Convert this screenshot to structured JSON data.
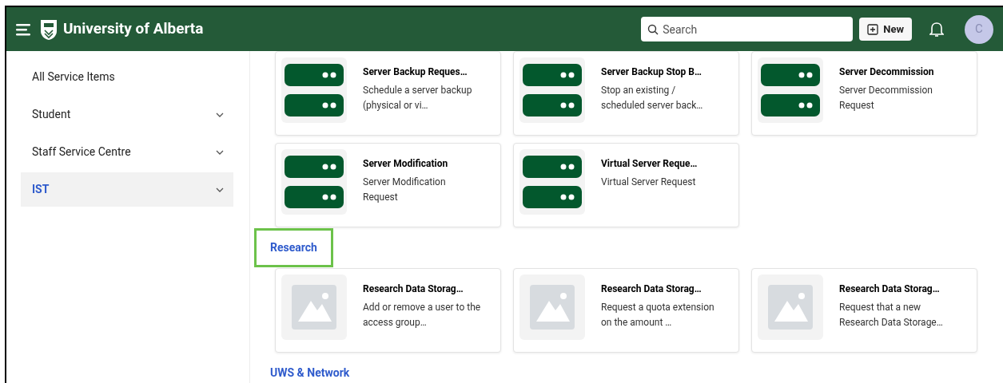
{
  "header": {
    "title": "University of Alberta",
    "search": {
      "placeholder": "Search"
    },
    "new_button": "New",
    "avatar": "C"
  },
  "sidebar": {
    "items": [
      {
        "label": "All Service Items",
        "selected": false,
        "expandable": false
      },
      {
        "label": "Student",
        "selected": false,
        "expandable": true
      },
      {
        "label": "Staff Service Centre",
        "selected": false,
        "expandable": true
      },
      {
        "label": "IST",
        "selected": true,
        "expandable": true
      }
    ]
  },
  "sections": [
    {
      "cards": [
        {
          "kind": "server",
          "title": "Server Backup Reques…",
          "description": "Schedule a server backup (physical or vi…"
        },
        {
          "kind": "server",
          "title": "Server Backup Stop B…",
          "description": "Stop an existing / scheduled server back…"
        },
        {
          "kind": "server",
          "title": "Server Decommission",
          "description": "Server Decommission Request"
        },
        {
          "kind": "server",
          "title": "Server Modification",
          "description": "Server Modification Request"
        },
        {
          "kind": "server",
          "title": "Virtual Server Reque…",
          "description": "Virtual Server Request"
        }
      ]
    },
    {
      "heading": "Research",
      "highlighted": true,
      "cards": [
        {
          "kind": "placeholder",
          "title": "Research Data Storag…",
          "description": "Add or remove a user to the access group…"
        },
        {
          "kind": "placeholder",
          "title": "Research Data Storag…",
          "description": "Request a quota extension on the amount …"
        },
        {
          "kind": "placeholder",
          "title": "Research Data Storag…",
          "description": "Request that a new Research Data Storage…"
        }
      ]
    },
    {
      "heading": "UWS & Network",
      "highlighted": false
    }
  ]
}
